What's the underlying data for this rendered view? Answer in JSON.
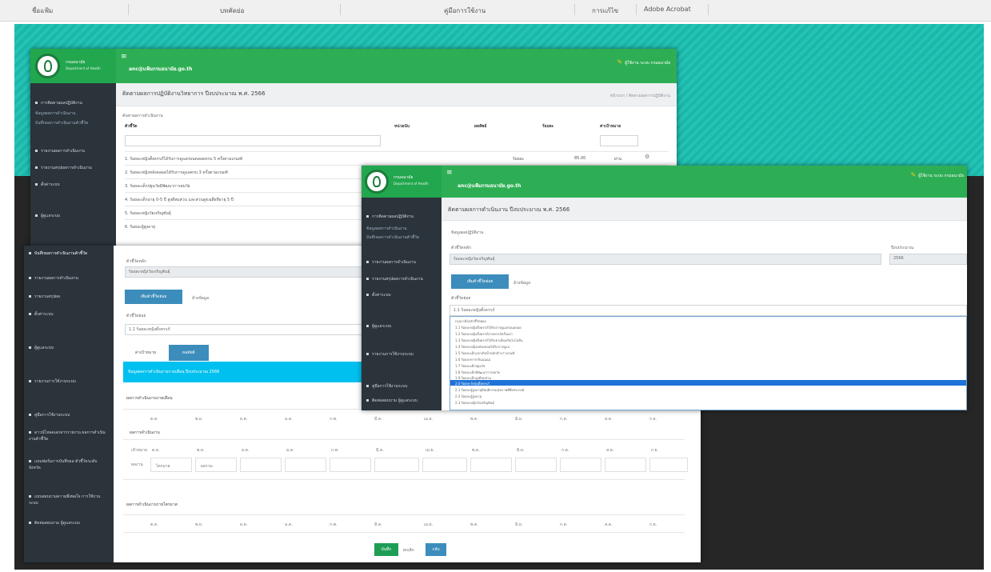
{
  "ribbon": {
    "items": [
      {
        "label": "ชื่อแฟ้ม"
      },
      {
        "label": "บทคัดย่อ"
      },
      {
        "label": "คู่มือการใช้งาน"
      },
      {
        "label": "การแก้ไข"
      },
      {
        "label": "Adobe Acrobat"
      }
    ]
  },
  "app": {
    "logo_line1": "กรมอนามัย",
    "logo_line2": "Department of Health",
    "topbar_title": "anc@แฟ้มกรมอนามัย.go.th",
    "user_label": "ผู้ใช้งาน ระบบ กรมอนามัย"
  },
  "win1": {
    "page_title": "ติดตามผลการปฏิบัติงานวิทยาการ ปีงบประมาณ พ.ศ. 2566",
    "breadcrumb": "หน้าแรก / ติดตามผลการปฏิบัติงาน",
    "filter_label": "ค้นหาผลการดำเนินงาน",
    "sidebar": [
      {
        "label": "การติดตามผลปฏิบัติงาน",
        "sub": false
      },
      {
        "label": "ข้อมูลผลการดำเนินงาน",
        "sub": true
      },
      {
        "label": "บันทึกผลการดำเนินงานตัวชี้วัด",
        "sub": true
      },
      {
        "label": "รายงานผลการดำเนินงาน",
        "sub": false
      },
      {
        "label": "รายงานสรุปผลการดำเนินงาน",
        "sub": false
      },
      {
        "label": "ตั้งค่าระบบ",
        "sub": false
      },
      {
        "label": "ผู้ดูแลระบบ",
        "sub": false
      }
    ],
    "columns": [
      "ตัวชี้วัด",
      "หน่วยนับ",
      "ผลลัพธ์",
      "ร้อยละ",
      "ค่าเป้าหมาย"
    ],
    "rows": [
      {
        "text": "1. ร้อยละหญิงตั้งครรภ์ได้รับการดูแลก่อนคลอดครบ 5 ครั้งตามเกณฑ์",
        "v1": "ร้อยละ",
        "v2": "85.00",
        "v3": "ผ่าน"
      },
      {
        "text": "2. ร้อยละหญิงหลังคลอดได้รับการดูแลครบ 3 ครั้งตามเกณฑ์"
      },
      {
        "text": "3. ร้อยละเด็กปฐมวัยมีพัฒนาการสมวัย"
      },
      {
        "text": "4. ร้อยละเด็กอายุ 0-5 ปี สูงดีสมส่วน และส่วนสูงเฉลี่ยที่อายุ 5 ปี"
      },
      {
        "text": "5. ร้อยละหญิงวัยเจริญพันธุ์"
      },
      {
        "text": "6. ร้อยละผู้สูงอายุ"
      }
    ]
  },
  "win2": {
    "sidebar": [
      {
        "label": "บันทึกผลการดำเนินงานตัวชี้วัด"
      },
      {
        "label": "รายงานผลการดำเนินงาน"
      },
      {
        "label": "รายงานสรุปผล"
      },
      {
        "label": "ตั้งค่าระบบ"
      },
      {
        "label": "ผู้ดูแลระบบ"
      },
      {
        "label": "รายงานการใช้งานระบบ"
      },
      {
        "label": "คู่มือการใช้งานระบบ"
      },
      {
        "label": "ดาวน์โหลดเอกสารรายงาน ผลการดำเนินงานตัวชี้วัด"
      },
      {
        "label": "แบบฟอร์มการบันทึกผล ตัวชี้วัดระดับจังหวัด"
      },
      {
        "label": "แบบสอบถามความพึงพอใจ การใช้งานระบบ"
      },
      {
        "label": "ติดต่อสอบถาม ผู้ดูแลระบบ"
      }
    ],
    "field_label": "ตัวชี้วัดหลัก",
    "field_value": "ร้อยละหญิงวัยเจริญพันธุ์",
    "btn_add": "เพิ่มตัวชี้วัดย่อย",
    "link_clear": "ล้างข้อมูล",
    "sub_label": "ตัวชี้วัดย่อย",
    "sub_value": "1.1 ร้อยละหญิงตั้งครรภ์",
    "tabs": [
      "ค่าเป้าหมาย",
      "ผลลัพธ์"
    ],
    "info": "ข้อมูลผลการดำเนินงานรายเดือน ปีงบประมาณ 2566",
    "section1": "ผลการดำเนินงานรายเดือน",
    "section2": "ผลการดำเนินงานรายไตรมาส",
    "sub_section": "ผลการดำเนินงาน",
    "months": [
      "ต.ค.",
      "พ.ย.",
      "ธ.ค.",
      "ม.ค.",
      "ก.พ.",
      "มี.ค.",
      "เม.ย.",
      "พ.ค.",
      "มิ.ย.",
      "ก.ค.",
      "ส.ค.",
      "ก.ย."
    ],
    "row_a": "เป้าหมาย",
    "row_b": "ผลงาน",
    "row_b_v1": "ไตรมาส",
    "row_b_v2": "ผลรวม",
    "btn_save": "บันทึก",
    "btn_cancel": "ยกเลิก",
    "btn_back": "กลับ"
  },
  "win3": {
    "page_title": "ติดตามผลการดำเนินงาน ปีงบประมาณ พ.ศ. 2566",
    "form_title": "ข้อมูลผลปฏิบัติงาน",
    "field_label": "ตัวชี้วัดหลัก",
    "field_value": "ร้อยละหญิงวัยเจริญพันธุ์",
    "right_label": "ปีงบประมาณ",
    "right_value": "2566",
    "btn_add": "เพิ่มตัวชี้วัดย่อย",
    "link_clear": "ล้างข้อมูล",
    "sub_label": "ตัวชี้วัดย่อย",
    "select_value": "1.1 ร้อยละหญิงตั้งครรภ์",
    "options": [
      "กรุณาเลือกตัวชี้วัดย่อย",
      "1.1 ร้อยละหญิงตั้งครรภ์ได้รับการดูแลก่อนคลอด",
      "1.2 ร้อยละหญิงตั้งครรภ์ฝากครรภ์ครั้งแรก",
      "1.3 ร้อยละหญิงตั้งครรภ์ได้รับยาเม็ดเสริมไอโอดีน",
      "1.4 ร้อยละหญิงหลังคลอดได้รับการดูแล",
      "1.5 ร้อยละเด็กแรกเกิดน้ำหนักต่ำกว่าเกณฑ์",
      "1.6 ร้อยละทารกกินนมแม่",
      "1.7 ร้อยละเด็กปฐมวัย",
      "1.8 ร้อยละเด็กมีพัฒนาการสมวัย",
      "1.9 ร้อยละเด็กสูงดีสมส่วน",
      "2.0 ร้อยละวัยรุ่นตั้งครรภ์",
      "2.1 ร้อยละผู้สูงอายุมีพฤติกรรมสุขภาพที่พึงประสงค์",
      "2.2 ร้อยละผู้สูงอายุ",
      "2.3 ร้อยละหญิงวัยเจริญพันธุ์"
    ],
    "selected_index": 10
  }
}
